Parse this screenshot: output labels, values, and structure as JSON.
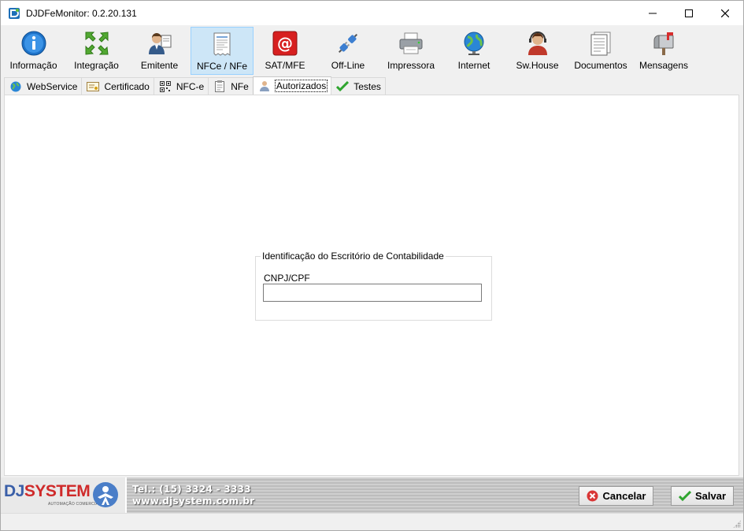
{
  "window": {
    "title": "DJDFeMonitor: 0.2.20.131"
  },
  "window_controls": {
    "minimize": "—",
    "maximize": "☐",
    "close": "✕"
  },
  "toolbar": {
    "items": [
      {
        "label": "Informação",
        "icon": "info-icon"
      },
      {
        "label": "Integração",
        "icon": "integration-arrows-icon"
      },
      {
        "label": "Emitente",
        "icon": "issuer-person-icon"
      },
      {
        "label": "NFCe / NFe",
        "icon": "invoice-icon",
        "active": true
      },
      {
        "label": "SAT/MFE",
        "icon": "at-sign-icon"
      },
      {
        "label": "Off-Line",
        "icon": "plug-icon"
      },
      {
        "label": "Impressora",
        "icon": "printer-icon"
      },
      {
        "label": "Internet",
        "icon": "globe-icon"
      },
      {
        "label": "Sw.House",
        "icon": "support-headset-icon"
      },
      {
        "label": "Documentos",
        "icon": "documents-icon"
      },
      {
        "label": "Mensagens",
        "icon": "mailbox-icon"
      }
    ]
  },
  "tabs": [
    {
      "label": "WebService",
      "icon": "globe-icon"
    },
    {
      "label": "Certificado",
      "icon": "certificate-icon"
    },
    {
      "label": "NFC-e",
      "icon": "qrcode-icon"
    },
    {
      "label": "NFe",
      "icon": "clipboard-icon"
    },
    {
      "label": "Autorizados",
      "icon": "user-icon",
      "active": true
    },
    {
      "label": "Testes",
      "icon": "check-icon"
    }
  ],
  "group": {
    "legend": "Identificação do Escritório de Contabilidade",
    "field_label": "CNPJ/CPF",
    "field_value": ""
  },
  "footer": {
    "brand_dj": "DJ",
    "brand_system": "SYSTEM",
    "brand_sub": "AUTOMAÇÃO COMERCIAL",
    "phone": "Tel.: (15) 3324 - 3333",
    "site": "www.djsystem.com.br",
    "cancel_label": "Cancelar",
    "save_label": "Salvar"
  },
  "colors": {
    "accent": "#cde6f7",
    "brand_blue": "#3a5fa8",
    "brand_red": "#cf2a2a"
  }
}
